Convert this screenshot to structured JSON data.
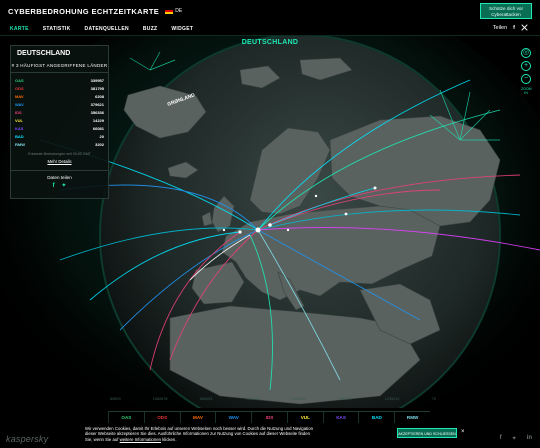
{
  "header": {
    "title": "CYBERBEDROHUNG ECHTZEITKARTE",
    "lang": "DE",
    "cta_line1": "Schütze dich vor",
    "cta_line2": "Cyberattacken"
  },
  "nav": {
    "items": [
      "KARTE",
      "STATISTIK",
      "DATENQUELLEN",
      "BUZZ",
      "WIDGET"
    ],
    "share": "Teilen"
  },
  "map": {
    "country_title": "DEUTSCHLAND",
    "map_label": "GRØNLAND"
  },
  "panel": {
    "country": "DEUTSCHLAND",
    "rank": "# 3 HÄUFIGST ANGEGRIFFENE LÄNDER",
    "stats": [
      {
        "label": "OAS",
        "value": "339957",
        "color": "#2ecc71"
      },
      {
        "label": "ODS",
        "value": "381795",
        "color": "#e53935"
      },
      {
        "label": "MAV",
        "value": "6208",
        "color": "#ff6d00"
      },
      {
        "label": "WAV",
        "value": "379621",
        "color": "#2196f3"
      },
      {
        "label": "IDS",
        "value": "356336",
        "color": "#ec407a"
      },
      {
        "label": "VUL",
        "value": "14229",
        "color": "#ffeb3b"
      },
      {
        "label": "KAS",
        "value": "66081",
        "color": "#7c4dff"
      },
      {
        "label": "BAD",
        "value": "20",
        "color": "#00e5ff"
      },
      {
        "label": "RMW",
        "value": "3202",
        "color": "#80deea"
      }
    ],
    "updated": "Erkannte Bedrohungen seit 00:00 GMT",
    "details": "Mehr Details",
    "share_label": "Daten teilen"
  },
  "controls": {
    "zoom_line1": "ZOOM",
    "zoom_line2": "IN"
  },
  "legend": {
    "numbers": [
      "80893",
      "1062878",
      "580003",
      "7434344",
      "1135939",
      "1189877",
      "1239012",
      "70"
    ],
    "items": [
      {
        "label": "OAS",
        "color": "#2ecc71"
      },
      {
        "label": "ODS",
        "color": "#e53935"
      },
      {
        "label": "MAV",
        "color": "#ff6d00"
      },
      {
        "label": "WAV",
        "color": "#2196f3"
      },
      {
        "label": "IDS",
        "color": "#ec407a"
      },
      {
        "label": "VUL",
        "color": "#ffeb3b"
      },
      {
        "label": "KAS",
        "color": "#7c4dff"
      },
      {
        "label": "BAD",
        "color": "#00e5ff"
      },
      {
        "label": "RMW",
        "color": "#80deea"
      }
    ]
  },
  "footer": {
    "brand": "kaspersky",
    "cookie_text_1": "Wir verwenden Cookies, damit Ihr Erlebnis auf unseren Webseiten noch besser wird. Durch die Nutzung und Navigation",
    "cookie_text_2": "dieser Webseite akzeptieren Sie dies. Ausführliche Informationen zur Nutzung von Cookies auf dieser Webseite finden",
    "cookie_text_3a": "Sie, wenn Sie auf",
    "cookie_link": "weitere Informationen",
    "cookie_text_3b": "klicken.",
    "accept": "AKZEPTIEREN UND SCHLIESSEN",
    "close": "×"
  },
  "icons": [
    "facebook-icon",
    "twitter-icon",
    "target-icon",
    "zoom-in-icon",
    "zoom-out-icon",
    "linkedin-icon",
    "close-icon"
  ]
}
